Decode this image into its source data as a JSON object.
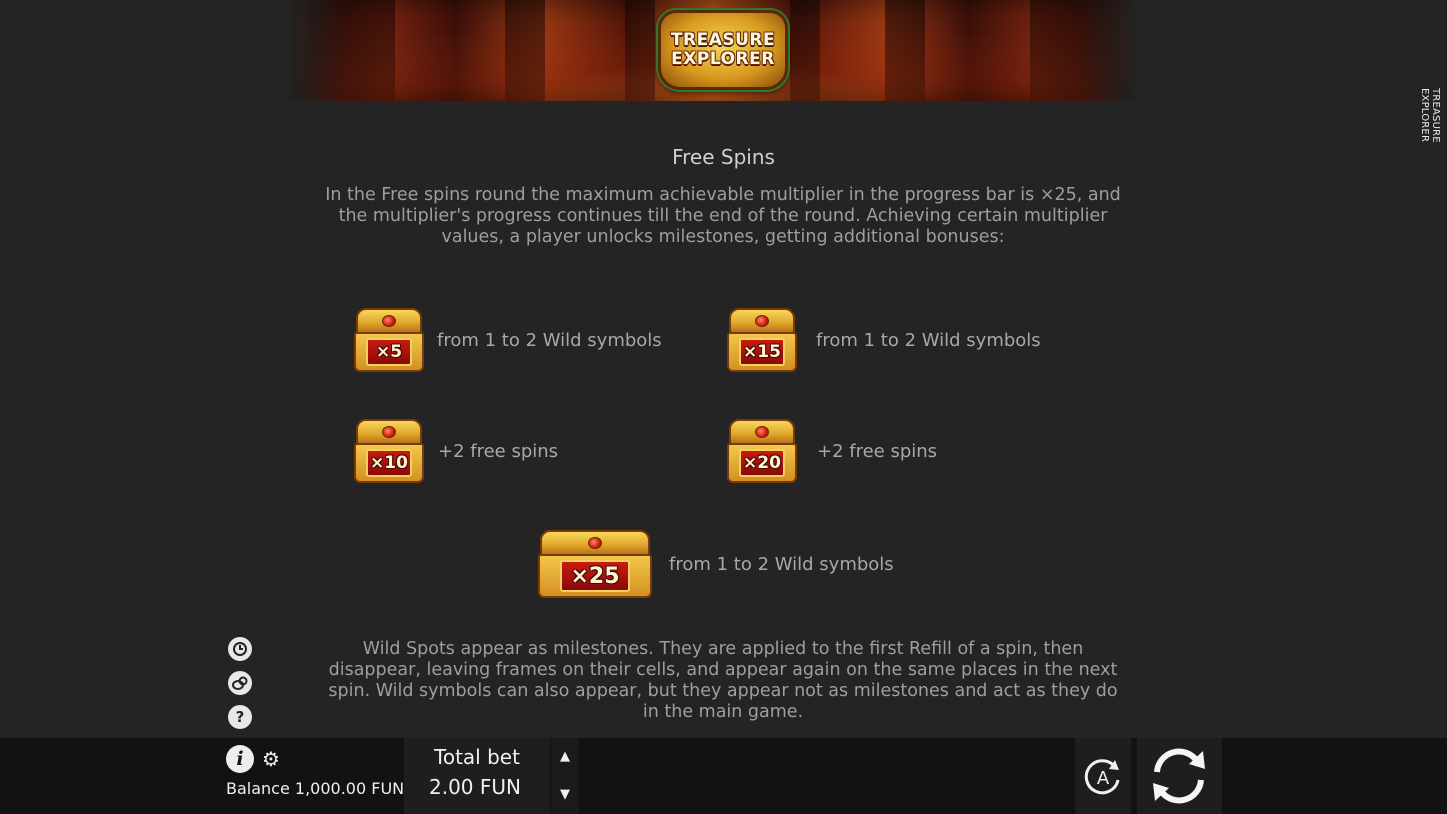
{
  "header": {
    "logo_line1": "TREASURE",
    "logo_line2": "EXPLORER"
  },
  "side_title": "TREASURE EXPLORER",
  "section": {
    "title": "Free Spins",
    "intro": "In the Free spins round the maximum achievable multiplier in the progress bar is ×25, and the multiplier's progress continues till the end of the round. Achieving certain multiplier values, a player unlocks milestones, getting additional bonuses:",
    "milestones": [
      {
        "multiplier": "×5",
        "text": "from 1 to 2 Wild symbols"
      },
      {
        "multiplier": "×15",
        "text": "from 1 to 2 Wild symbols"
      },
      {
        "multiplier": "×10",
        "text": "+2 free spins"
      },
      {
        "multiplier": "×20",
        "text": "+2 free spins"
      },
      {
        "multiplier": "×25",
        "text": "from 1 to 2 Wild symbols"
      }
    ],
    "outro": "Wild Spots appear as milestones. They are applied to the first Refill of a spin, then disappear, leaving frames on their cells, and appear again on the same places in the next spin. Wild symbols can also appear, but they appear not as milestones and act as they do in the main game."
  },
  "side_icons": [
    "history-icon",
    "bet-coins-icon",
    "help-icon"
  ],
  "bottom_bar": {
    "balance": "Balance 1,000.00 FUN",
    "total_bet_label": "Total bet",
    "total_bet_value": "2.00 FUN",
    "auto_label": "A"
  },
  "colors": {
    "background": "#242424",
    "bottom_bar": "#121212",
    "text_main": "#9e9e9e",
    "chest_gold": "#e0a52a",
    "plate_red": "#c81a10"
  }
}
